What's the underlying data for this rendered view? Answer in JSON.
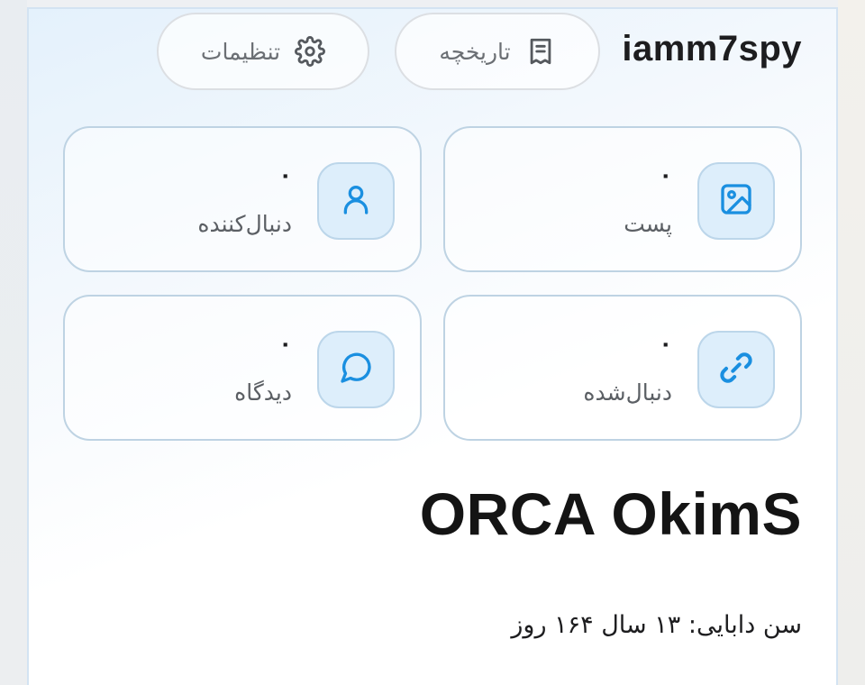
{
  "profile": {
    "username": "iamm7spy",
    "display_name": "ORCA OkimS",
    "age_text": "سن دابایی: ۱۳ سال ۱۶۴ روز"
  },
  "header": {
    "history_label": "تاریخچه",
    "settings_label": "تنظیمات"
  },
  "stats": {
    "posts": {
      "value": "۰",
      "label": "پست",
      "icon": "image-icon"
    },
    "followers": {
      "value": "۰",
      "label": "دنبال‌کننده",
      "icon": "user-icon"
    },
    "following": {
      "value": "۰",
      "label": "دنبال‌شده",
      "icon": "link-icon"
    },
    "comments": {
      "value": "۰",
      "label": "دیدگاه",
      "icon": "chat-bubble-icon"
    }
  },
  "colors": {
    "accent": "#1a8fe0",
    "icon_box_bg": "#ddeefb",
    "card_border": "#bed3e3"
  }
}
